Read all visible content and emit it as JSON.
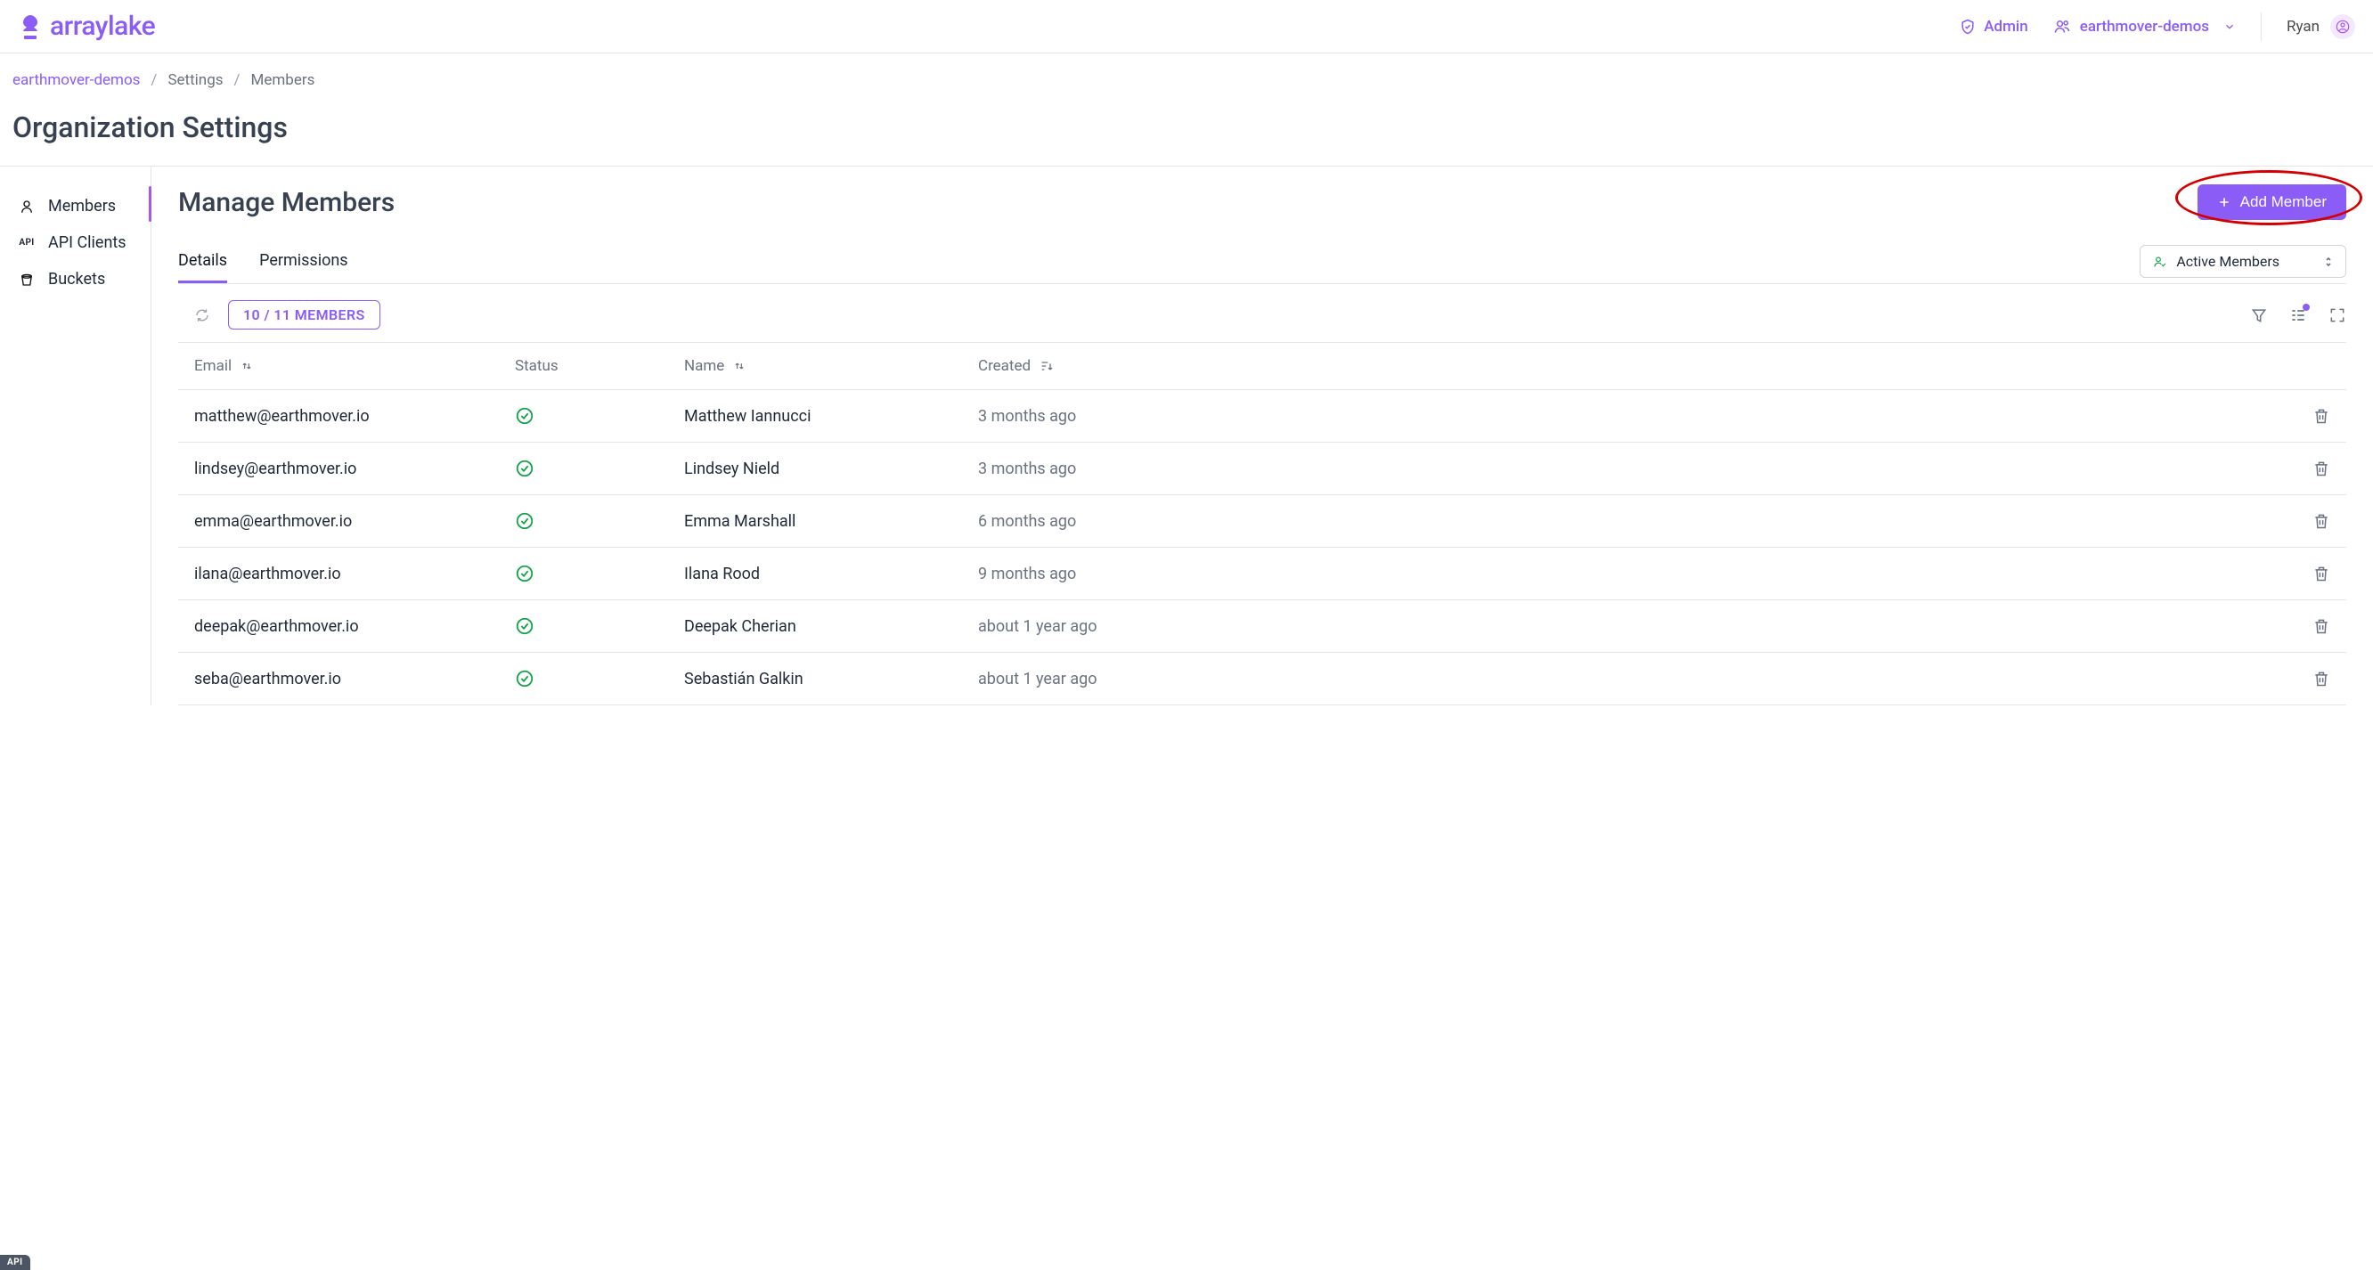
{
  "header": {
    "logo_text": "arraylake",
    "admin_label": "Admin",
    "org_name": "earthmover-demos",
    "user_name": "Ryan"
  },
  "breadcrumb": {
    "org": "earthmover-demos",
    "settings": "Settings",
    "members": "Members"
  },
  "page": {
    "title": "Organization Settings",
    "section_title": "Manage Members",
    "add_button": "Add Member"
  },
  "sidebar": {
    "items": [
      {
        "label": "Members"
      },
      {
        "label": "API Clients"
      },
      {
        "label": "Buckets"
      }
    ]
  },
  "tabs": {
    "details": "Details",
    "permissions": "Permissions"
  },
  "filter": {
    "selected": "Active Members"
  },
  "toolbar": {
    "count_label": "10 / 11 MEMBERS"
  },
  "table": {
    "headers": {
      "email": "Email",
      "status": "Status",
      "name": "Name",
      "created": "Created"
    },
    "rows": [
      {
        "email": "matthew@earthmover.io",
        "name": "Matthew Iannucci",
        "created": "3 months ago"
      },
      {
        "email": "lindsey@earthmover.io",
        "name": "Lindsey Nield",
        "created": "3 months ago"
      },
      {
        "email": "emma@earthmover.io",
        "name": "Emma Marshall",
        "created": "6 months ago"
      },
      {
        "email": "ilana@earthmover.io",
        "name": "Ilana Rood",
        "created": "9 months ago"
      },
      {
        "email": "deepak@earthmover.io",
        "name": "Deepak Cherian",
        "created": "about 1 year ago"
      },
      {
        "email": "seba@earthmover.io",
        "name": "Sebastián Galkin",
        "created": "about 1 year ago"
      }
    ]
  },
  "footer_tag": "API"
}
